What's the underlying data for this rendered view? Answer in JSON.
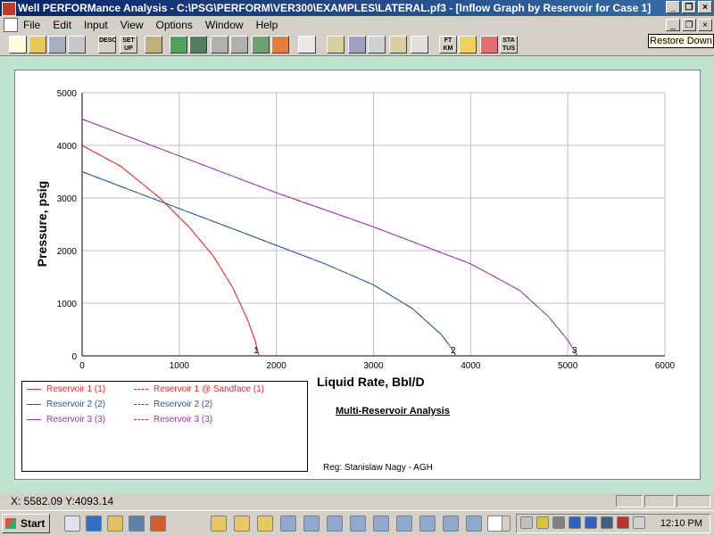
{
  "window": {
    "title": "Well PERFORMance Analysis - C:\\PSG\\PERFORM\\VER300\\EXAMPLES\\LATERAL.pf3 - [Inflow Graph by Reservoir for Case 1]",
    "minimize": "_",
    "restore": "❐",
    "close": "×"
  },
  "menu": {
    "items": [
      "File",
      "Edit",
      "Input",
      "View",
      "Options",
      "Window",
      "Help"
    ]
  },
  "toolbar": {
    "desc_label": "DESC",
    "setup_label": "SET UP",
    "ft_label": "FT KM",
    "status_label": "STA TUS",
    "tooltip": "Restore Down"
  },
  "chart_data": {
    "type": "line",
    "title": "Multi-Reservoir Analysis",
    "xlabel": "Liquid Rate, Bbl/D",
    "ylabel": "Pressure, psig",
    "xlim": [
      0,
      6000
    ],
    "ylim": [
      0,
      5000
    ],
    "xticks": [
      "0",
      "1000",
      "2000",
      "3000",
      "4000",
      "5000",
      "6000"
    ],
    "yticks": [
      "0",
      "1000",
      "2000",
      "3000",
      "4000",
      "5000"
    ],
    "grid": true,
    "legend_position": "bottom-left",
    "series": [
      {
        "name": "Reservoir 1 (1)",
        "color": "#e03030",
        "style": "solid",
        "end_label": "1",
        "x": [
          0,
          400,
          800,
          1100,
          1350,
          1550,
          1700,
          1780,
          1820
        ],
        "y": [
          4000,
          3600,
          3000,
          2450,
          1900,
          1300,
          700,
          300,
          0
        ]
      },
      {
        "name": "Reservoir 1 @ Sandface (1)",
        "color": "#e03030",
        "style": "dashed",
        "x": [
          0,
          400,
          800,
          1100,
          1350,
          1550,
          1700,
          1780,
          1820
        ],
        "y": [
          4000,
          3600,
          3000,
          2450,
          1900,
          1300,
          700,
          300,
          0
        ]
      },
      {
        "name": "Reservoir 2 (2)",
        "color": "#2a5a9a",
        "style": "solid",
        "end_label": "2",
        "x": [
          0,
          500,
          1000,
          1500,
          2000,
          2500,
          3000,
          3400,
          3700,
          3800,
          3850
        ],
        "y": [
          3500,
          3150,
          2800,
          2450,
          2100,
          1750,
          1350,
          900,
          400,
          150,
          0
        ]
      },
      {
        "name": "Reservoir 2 (2)",
        "color": "#2a5a9a",
        "style": "dashed",
        "x": [
          0,
          500,
          1000,
          1500,
          2000,
          2500,
          3000,
          3400,
          3700,
          3800,
          3850
        ],
        "y": [
          3500,
          3150,
          2800,
          2450,
          2100,
          1750,
          1350,
          900,
          400,
          150,
          0
        ]
      },
      {
        "name": "Reservoir 3 (3)",
        "color": "#9a3aa8",
        "style": "solid",
        "end_label": "3",
        "x": [
          0,
          1000,
          2000,
          3000,
          4000,
          4500,
          4800,
          5000,
          5100
        ],
        "y": [
          4500,
          3800,
          3100,
          2450,
          1750,
          1250,
          750,
          300,
          0
        ]
      },
      {
        "name": "Reservoir 3 (3)",
        "color": "#9a3aa8",
        "style": "dashed",
        "x": [
          0,
          1000,
          2000,
          3000,
          4000,
          4500,
          4800,
          5000,
          5100
        ],
        "y": [
          4500,
          3800,
          3100,
          2450,
          1750,
          1250,
          750,
          300,
          0
        ]
      }
    ]
  },
  "footer": {
    "registration": "Reg:  Stanislaw Nagy - AGH"
  },
  "statusbar": {
    "coords": "X: 5582.09  Y:4093.14"
  },
  "taskbar": {
    "start": "Start",
    "clock": "12:10 PM"
  }
}
